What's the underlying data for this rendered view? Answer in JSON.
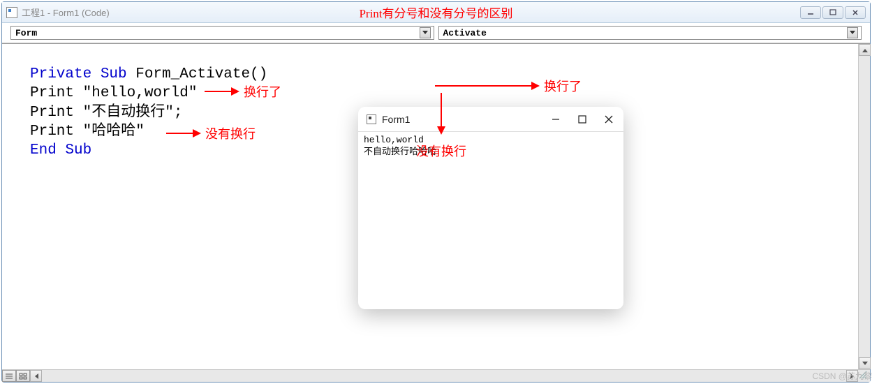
{
  "window": {
    "title": "工程1 - Form1 (Code)",
    "annotation_title": "Print有分号和没有分号的区别"
  },
  "dropdowns": {
    "object_selected": "Form",
    "proc_selected": "Activate"
  },
  "code": {
    "l1_kw1": "Private Sub",
    "l1_rest": " Form_Activate()",
    "l2": "Print \"hello,world\"",
    "l3": "Print \"不自动换行\";",
    "l4": "Print \"哈哈哈\"",
    "l5": "End Sub"
  },
  "annotations": {
    "a1": "换行了",
    "a2": "没有换行",
    "a3": "换行了",
    "a4": "没有换行"
  },
  "form1": {
    "title": "Form1",
    "output_line1": "hello,world",
    "output_line2": "不自动换行哈哈哈"
  },
  "watermark": "CSDN @苏九黎"
}
